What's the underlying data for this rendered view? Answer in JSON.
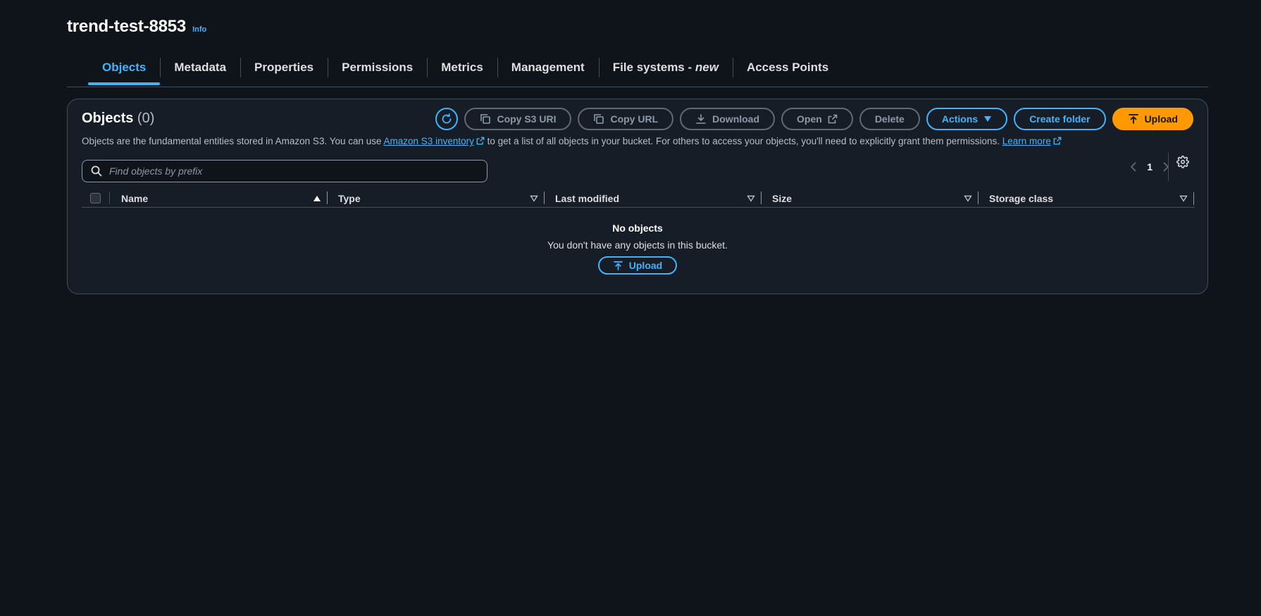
{
  "header": {
    "bucket_name": "trend-test-8853",
    "info_label": "Info"
  },
  "tabs": [
    {
      "label": "Objects",
      "active": true
    },
    {
      "label": "Metadata"
    },
    {
      "label": "Properties"
    },
    {
      "label": "Permissions"
    },
    {
      "label": "Metrics"
    },
    {
      "label": "Management"
    },
    {
      "label": "File systems",
      "suffix_dash": " - ",
      "suffix_new": "new"
    },
    {
      "label": "Access Points"
    }
  ],
  "objects_panel": {
    "title": "Objects",
    "count": "(0)",
    "description_before": "Objects are the fundamental entities stored in Amazon S3. You can use ",
    "inventory_link": "Amazon S3 inventory",
    "description_middle": " to get a list of all objects in your bucket. For others to access your objects, you'll need to explicitly grant them permissions. ",
    "learn_more_link": "Learn more"
  },
  "toolbar": {
    "refresh_icon": "refresh-icon",
    "copy_s3_uri": "Copy S3 URI",
    "copy_url": "Copy URL",
    "download": "Download",
    "open": "Open",
    "delete": "Delete",
    "actions": "Actions",
    "create_folder": "Create folder",
    "upload": "Upload"
  },
  "search": {
    "placeholder": "Find objects by prefix",
    "value": ""
  },
  "pagination": {
    "current_page": "1"
  },
  "table": {
    "columns": [
      "Name",
      "Type",
      "Last modified",
      "Size",
      "Storage class"
    ],
    "sort_column": "Name",
    "sort_direction": "ascending"
  },
  "empty_state": {
    "title": "No objects",
    "message": "You don't have any objects in this bucket.",
    "upload_label": "Upload"
  },
  "colors": {
    "background": "#0f141a",
    "panel": "#161d26",
    "accent": "#42b4ff",
    "primary_button": "#ff9900",
    "disabled": "#8d99a8"
  }
}
